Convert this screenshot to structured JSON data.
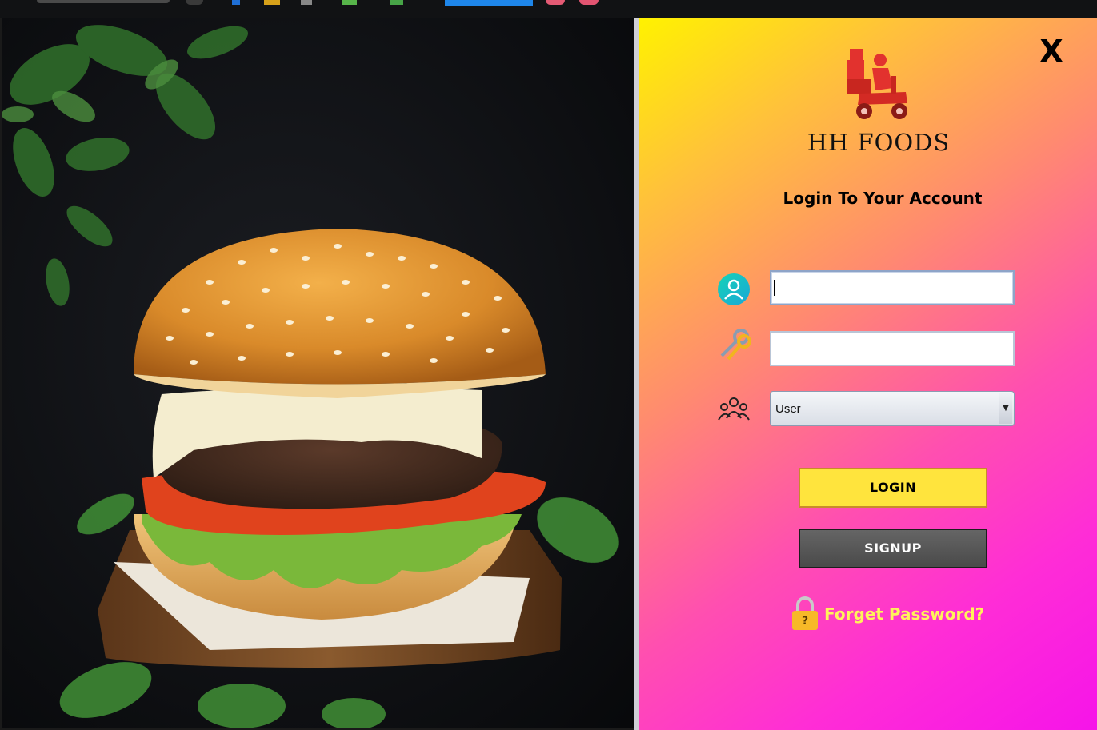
{
  "window": {
    "close_label": "X"
  },
  "brand": {
    "name": "HH FOODS",
    "logo_icon": "delivery-scooter-icon"
  },
  "login": {
    "heading": "Login To Your Account",
    "username": {
      "icon": "user-circle-icon",
      "value": "",
      "placeholder": ""
    },
    "password": {
      "icon": "keys-icon",
      "value": "",
      "placeholder": ""
    },
    "role": {
      "icon": "user-group-icon",
      "selected": "User"
    },
    "login_button": "LOGIN",
    "signup_button": "SIGNUP",
    "forgot_link": "Forget Password?",
    "forgot_icon": "padlock-icon"
  },
  "colors": {
    "panel_gradient_start": "#fff200",
    "panel_gradient_end": "#f614e9",
    "login_button": "#ffe43d",
    "signup_button": "#555555",
    "forgot_text": "#fff35a"
  }
}
